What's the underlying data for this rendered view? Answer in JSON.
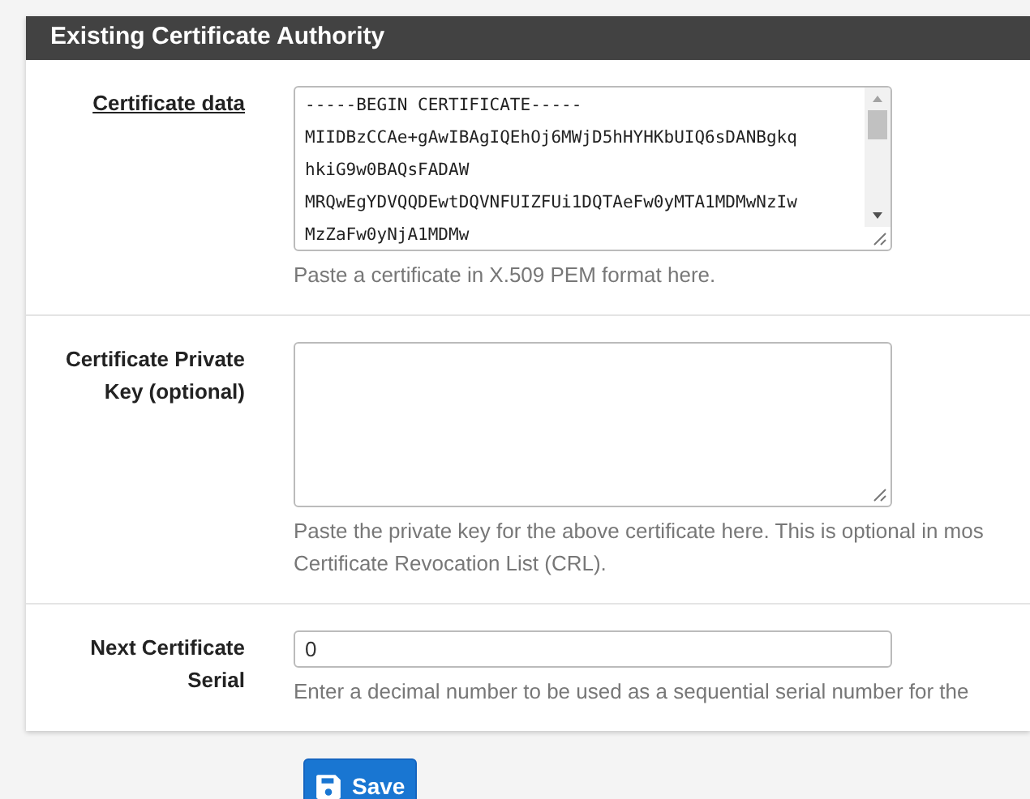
{
  "panel": {
    "title": "Existing Certificate Authority"
  },
  "fields": [
    {
      "kind": "textarea",
      "label": "Certificate data",
      "underlined": true,
      "lines": [
        "-----BEGIN CERTIFICATE-----",
        "MIIDBzCCAe+gAwIBAgIQEhOj6MWjD5hHYHKbUIQ6sDANBgkq",
        "hkiG9w0BAQsFADAW",
        "MRQwEgYDVQQDEwtDQVNFUIZFUi1DQTAeFw0yMTA1MDMwNzIw",
        "MzZaFw0yNjA1MDMw"
      ],
      "help": [
        "Paste a certificate in X.509 PEM format here."
      ]
    },
    {
      "kind": "textarea",
      "label": "Certificate Private Key (optional)",
      "underlined": false,
      "help": [
        "Paste the private key for the above certificate here. This is optional in mos",
        "Certificate Revocation List (CRL)."
      ]
    },
    {
      "kind": "input",
      "label": "Next Certificate Serial",
      "underlined": false,
      "value": "0",
      "help": [
        "Enter a decimal number to be used as a sequential serial number for the"
      ]
    }
  ],
  "save_button": {
    "label": "Save"
  }
}
